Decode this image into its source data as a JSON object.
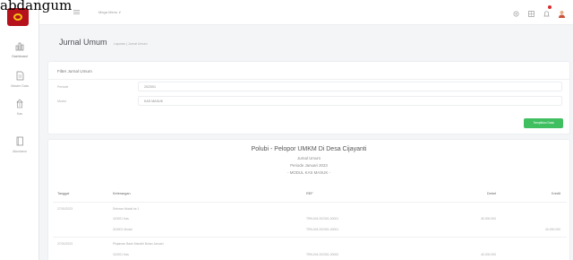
{
  "overlay_text": "abdangum",
  "sidebar": {
    "items": [
      {
        "label": "Dashboard",
        "icon": "chart-icon"
      },
      {
        "label": "Master Data",
        "icon": "document-icon"
      },
      {
        "label": "Kas",
        "icon": "money-icon"
      },
      {
        "label": "Akuntansi",
        "icon": "book-icon"
      }
    ]
  },
  "topbar": {
    "menu_label": "Mega Menu ∨"
  },
  "page": {
    "title": "Jurnal Umum",
    "breadcrumb": "Laporan | Jurnal Umum"
  },
  "filter": {
    "title": "Filter Jurnal Umum",
    "period_label": "Periode",
    "period_value": "2023/01",
    "module_label": "Modul",
    "module_value": "KAS MASUK",
    "show_button": "Tampilkan Data"
  },
  "report": {
    "company": "Polubi - Pelopor UMKM Di Desa Cijayanti",
    "title": "Jurnal Umum",
    "period": "Periode Januari 2023",
    "module": "- MODUL KAS MASUK -",
    "columns": [
      "Tanggal",
      "Keterangan",
      "REF",
      "Debet",
      "Kredit"
    ],
    "rows": [
      {
        "date": "27/01/2023",
        "desc": "Setoran Modal ke 1",
        "ref": "",
        "debit": "",
        "credit": ""
      },
      {
        "date": "",
        "desc": "110001 Kas",
        "ref": "TRN-KM-202301-00001",
        "debit": "40.000.000",
        "credit": ""
      },
      {
        "date": "",
        "desc": "310001 Modal",
        "ref": "TRN-KM-202301-00001",
        "debit": "",
        "credit": "40.000.000"
      },
      {
        "date": "27/01/2023",
        "desc": "Pinjaman Bank Mandiri Bulan Januari",
        "ref": "",
        "debit": "",
        "credit": ""
      },
      {
        "date": "",
        "desc": "110001 Kas",
        "ref": "TRN-KM-202301-00002",
        "debit": "40.000.000",
        "credit": ""
      }
    ]
  },
  "colors": {
    "brand": "#b5121b",
    "accent_button": "#3fbf60",
    "notification": "#d92d2d"
  }
}
